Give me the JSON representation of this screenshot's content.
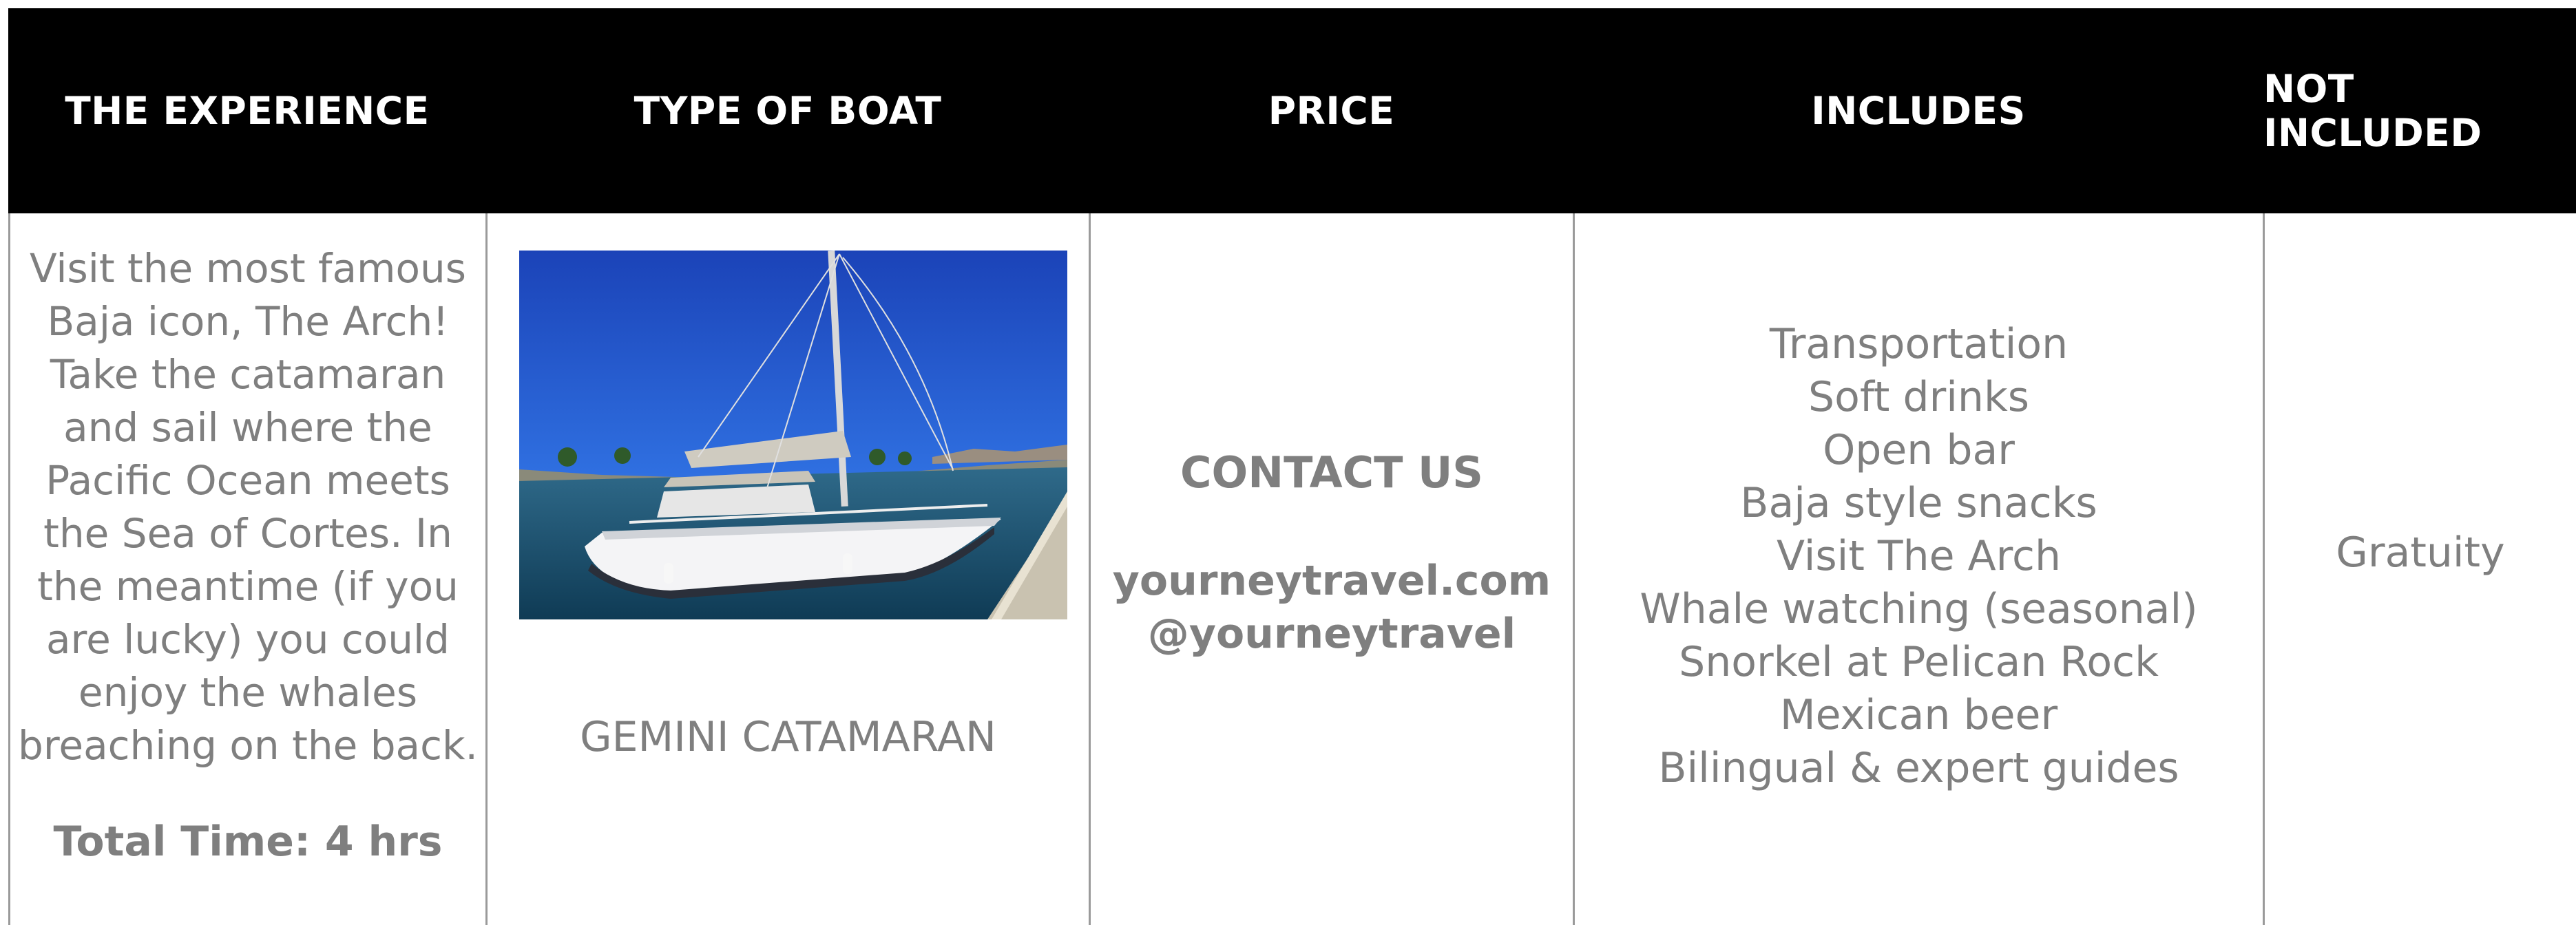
{
  "header": {
    "experience": "THE EXPERIENCE",
    "boat_type": "TYPE OF BOAT",
    "price": "PRICE",
    "includes": "INCLUDES",
    "not_included": "NOT INCLUDED"
  },
  "experience": {
    "lines": [
      "Visit the most famous",
      "Baja icon, The Arch!",
      "Take the catamaran",
      "and sail where the",
      "Pacific Ocean meets",
      "the Sea of Cortes. In",
      "the meantime (if you",
      "are lucky) you could",
      "enjoy the whales",
      "breaching on the back."
    ],
    "total_time": "Total Time: 4 hrs"
  },
  "boat": {
    "photo_icon": "sailboat-photo",
    "name": "GEMINI CATAMARAN"
  },
  "price": {
    "title": "CONTACT US",
    "website": "yourneytravel.com",
    "handle": "@yourneytravel"
  },
  "includes": {
    "items": [
      "Transportation",
      "Soft drinks",
      "Open bar",
      "Baja style snacks",
      "Visit The Arch",
      "Whale watching (seasonal)",
      "Snorkel at Pelican Rock",
      "Mexican beer",
      "Bilingual & expert guides"
    ]
  },
  "not_included": {
    "item": "Gratuity"
  },
  "colors": {
    "header_bg": "#000000",
    "header_text": "#ffffff",
    "body_text": "#7f7f7f",
    "grid_line": "#9a9a9a"
  }
}
